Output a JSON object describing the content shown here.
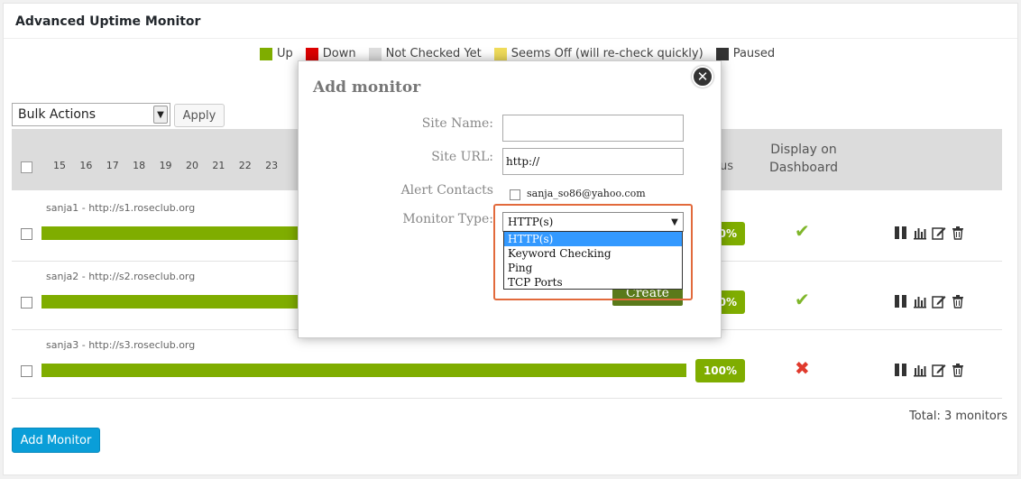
{
  "panel": {
    "title": "Advanced Uptime Monitor"
  },
  "legend": [
    {
      "label": "Up",
      "color": "#7fad00"
    },
    {
      "label": "Down",
      "color": "#dd0000"
    },
    {
      "label": "Not Checked Yet",
      "color": "#dddddd"
    },
    {
      "label": "Seems Off (will re-check quickly)",
      "color": "#f0dc5a"
    },
    {
      "label": "Paused",
      "color": "#333333"
    }
  ],
  "toolbar": {
    "bulk_actions": "Bulk Actions",
    "apply": "Apply"
  },
  "table_header": {
    "days": [
      "15",
      "16",
      "17",
      "18",
      "19",
      "20",
      "21",
      "22",
      "23"
    ],
    "status": "us",
    "display_on_dashboard": "Display on Dashboard"
  },
  "rows": [
    {
      "site": "sanja1 - http://s1.roseclub.org",
      "uptime": "100%",
      "dashboard": "check"
    },
    {
      "site": "sanja2 - http://s2.roseclub.org",
      "uptime": "100%",
      "dashboard": "check"
    },
    {
      "site": "sanja3 - http://s3.roseclub.org",
      "uptime": "100%",
      "dashboard": "cross"
    }
  ],
  "footer": {
    "total": "Total: 3 monitors",
    "add_monitor": "Add Monitor"
  },
  "modal": {
    "title": "Add monitor",
    "site_name_label": "Site Name:",
    "site_name_value": "",
    "site_url_label": "Site URL:",
    "site_url_value": "http://",
    "alert_contacts_label": "Alert Contacts",
    "alert_contact_email": "sanja_so86@yahoo.com",
    "monitor_type_label": "Monitor Type:",
    "monitor_type_selected": "HTTP(s)",
    "monitor_type_options": [
      "HTTP(s)",
      "Keyword Checking",
      "Ping",
      "TCP Ports"
    ],
    "create": "Create"
  }
}
